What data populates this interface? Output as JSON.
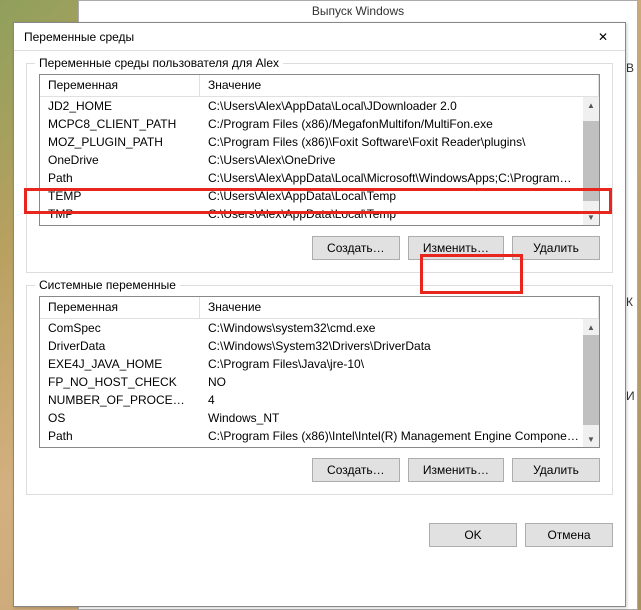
{
  "bg_window": {
    "title": "Выпуск Windows"
  },
  "dialog": {
    "title": "Переменные среды"
  },
  "user_section": {
    "label": "Переменные среды пользователя для Alex",
    "col_var": "Переменная",
    "col_val": "Значение",
    "rows": [
      {
        "var": "JD2_HOME",
        "val": "C:\\Users\\Alex\\AppData\\Local\\JDownloader 2.0"
      },
      {
        "var": "MCPC8_CLIENT_PATH",
        "val": "C:/Program Files (x86)/MegafonMultifon/MultiFon.exe"
      },
      {
        "var": "MOZ_PLUGIN_PATH",
        "val": "C:\\Program Files (x86)\\Foxit Software\\Foxit Reader\\plugins\\"
      },
      {
        "var": "OneDrive",
        "val": "C:\\Users\\Alex\\OneDrive"
      },
      {
        "var": "Path",
        "val": "C:\\Users\\Alex\\AppData\\Local\\Microsoft\\WindowsApps;C:\\Program…"
      },
      {
        "var": "TEMP",
        "val": "C:\\Users\\Alex\\AppData\\Local\\Temp"
      },
      {
        "var": "TMP",
        "val": "C:\\Users\\Alex\\AppData\\Local\\Temp"
      }
    ]
  },
  "sys_section": {
    "label": "Системные переменные",
    "col_var": "Переменная",
    "col_val": "Значение",
    "rows": [
      {
        "var": "ComSpec",
        "val": "C:\\Windows\\system32\\cmd.exe"
      },
      {
        "var": "DriverData",
        "val": "C:\\Windows\\System32\\Drivers\\DriverData"
      },
      {
        "var": "EXE4J_JAVA_HOME",
        "val": "C:\\Program Files\\Java\\jre-10\\"
      },
      {
        "var": "FP_NO_HOST_CHECK",
        "val": "NO"
      },
      {
        "var": "NUMBER_OF_PROCESSORS",
        "val": "4"
      },
      {
        "var": "OS",
        "val": "Windows_NT"
      },
      {
        "var": "Path",
        "val": "C:\\Program Files (x86)\\Intel\\Intel(R) Management Engine Compone…"
      }
    ]
  },
  "buttons": {
    "create": "Создать…",
    "edit": "Изменить…",
    "delete": "Удалить",
    "ok": "OK",
    "cancel": "Отмена"
  },
  "bg_side": {
    "a": "В",
    "b": "К",
    "c": "И"
  }
}
